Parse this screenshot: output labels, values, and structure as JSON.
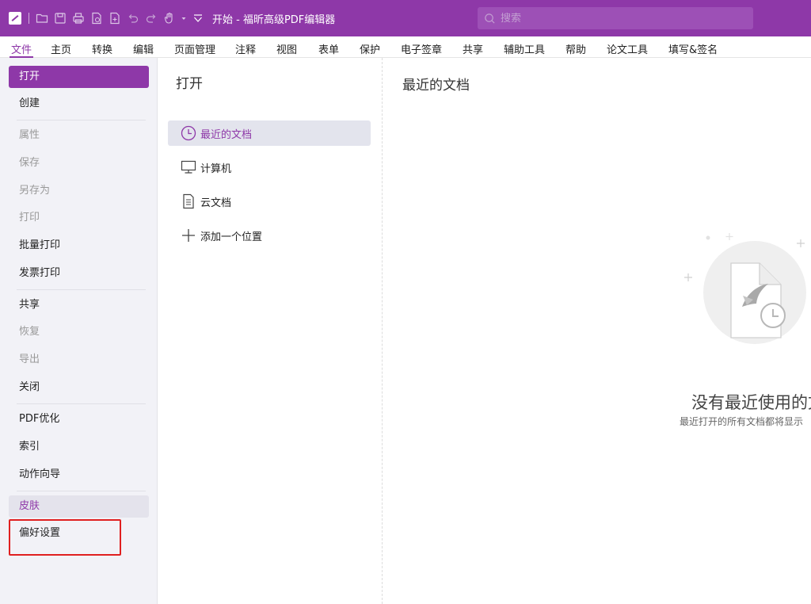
{
  "titlebar": {
    "title": "开始 - 福昕高级PDF编辑器",
    "search_placeholder": "搜索",
    "quick_access_icons": [
      "open-folder-icon",
      "save-icon",
      "print-icon",
      "pdf-create-icon",
      "new-file-icon",
      "undo-icon",
      "redo-icon",
      "hand-tool-icon",
      "customize-dropdown-icon"
    ]
  },
  "menu": {
    "items": [
      "文件",
      "主页",
      "转换",
      "编辑",
      "页面管理",
      "注释",
      "视图",
      "表单",
      "保护",
      "电子签章",
      "共享",
      "辅助工具",
      "帮助",
      "论文工具",
      "填写&签名"
    ],
    "active": "文件"
  },
  "sidebar": {
    "items": [
      {
        "label": "打开",
        "state": "selected"
      },
      {
        "label": "创建",
        "state": "normal"
      },
      {
        "label": "属性",
        "state": "disabled"
      },
      {
        "label": "保存",
        "state": "disabled"
      },
      {
        "label": "另存为",
        "state": "disabled"
      },
      {
        "label": "打印",
        "state": "disabled"
      },
      {
        "label": "批量打印",
        "state": "normal"
      },
      {
        "label": "发票打印",
        "state": "normal"
      },
      {
        "label": "共享",
        "state": "normal"
      },
      {
        "label": "恢复",
        "state": "disabled"
      },
      {
        "label": "导出",
        "state": "disabled"
      },
      {
        "label": "关闭",
        "state": "normal"
      },
      {
        "label": "PDF优化",
        "state": "normal"
      },
      {
        "label": "索引",
        "state": "normal"
      },
      {
        "label": "动作向导",
        "state": "normal"
      },
      {
        "label": "皮肤",
        "state": "hover"
      },
      {
        "label": "偏好设置",
        "state": "normal"
      }
    ]
  },
  "open_panel": {
    "title": "打开",
    "locations": [
      {
        "label": "最近的文档",
        "icon": "clock-icon",
        "selected": true
      },
      {
        "label": "计算机",
        "icon": "computer-icon",
        "selected": false
      },
      {
        "label": "云文档",
        "icon": "cloud-document-icon",
        "selected": false
      },
      {
        "label": "添加一个位置",
        "icon": "add-location-icon",
        "selected": false
      }
    ]
  },
  "recent": {
    "title": "最近的文档",
    "empty_title": "没有最近使用的文",
    "empty_subtitle": "最近打开的所有文档都将显示"
  },
  "colors": {
    "brand": "#8e38a8",
    "highlight_box": "#e02020"
  }
}
